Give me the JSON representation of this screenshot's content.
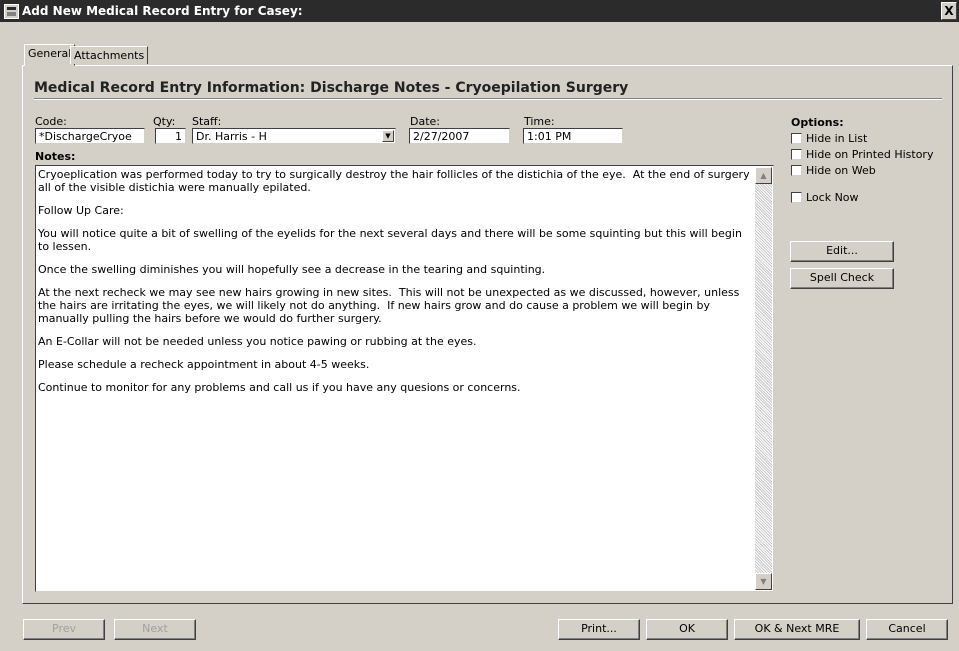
{
  "window": {
    "title": "Add New Medical Record Entry for Casey:",
    "close": "X"
  },
  "tabs": [
    {
      "label": "General"
    },
    {
      "label": "Attachments"
    }
  ],
  "section": {
    "title": "Medical Record Entry Information:  Discharge Notes - Cryoepilation Surgery"
  },
  "fields": {
    "code": {
      "label": "Code:",
      "value": "*DischargeCryoe"
    },
    "qty": {
      "label": "Qty:",
      "value": "1"
    },
    "staff": {
      "label": "Staff:",
      "value": "Dr. Harris - H"
    },
    "date": {
      "label": "Date:",
      "value": "2/27/2007"
    },
    "time": {
      "label": "Time:",
      "value": "1:01 PM"
    }
  },
  "notes": {
    "label": "Notes:",
    "paragraphs": [
      "Cryoeplication was performed today to try to surgically destroy the hair follicles of the distichia of the eye.  At the end of surgery all of the visible distichia were manually epilated.",
      "Follow Up Care:",
      "You will notice quite a bit of swelling of the eyelids for the next several days and there will be some squinting but this will begin to lessen.",
      "Once the swelling diminishes you will hopefully see a decrease in the tearing and squinting.",
      "At the next recheck we may see new hairs growing in new sites.  This will not be unexpected as we discussed, however, unless the hairs are irritating the eyes, we will likely not do anything.  If new hairs grow and do cause a problem we will begin by manually pulling the hairs before we would do further surgery.",
      "An E-Collar will not be needed unless you notice pawing or rubbing at the eyes.",
      "Please schedule a recheck appointment in about 4-5 weeks.",
      "Continue to monitor for any problems and call us if you have any quesions or concerns."
    ]
  },
  "options": {
    "title": "Options:",
    "items": [
      {
        "label": "Hide in List",
        "checked": false
      },
      {
        "label": "Hide on Printed History",
        "checked": false
      },
      {
        "label": "Hide on Web",
        "checked": false
      },
      {
        "label": "Lock Now",
        "checked": false
      }
    ]
  },
  "side_buttons": {
    "edit": "Edit...",
    "spell_check": "Spell Check"
  },
  "footer": {
    "prev": "Prev",
    "next": "Next",
    "print": "Print...",
    "ok": "OK",
    "ok_next": "OK & Next MRE",
    "cancel": "Cancel"
  }
}
